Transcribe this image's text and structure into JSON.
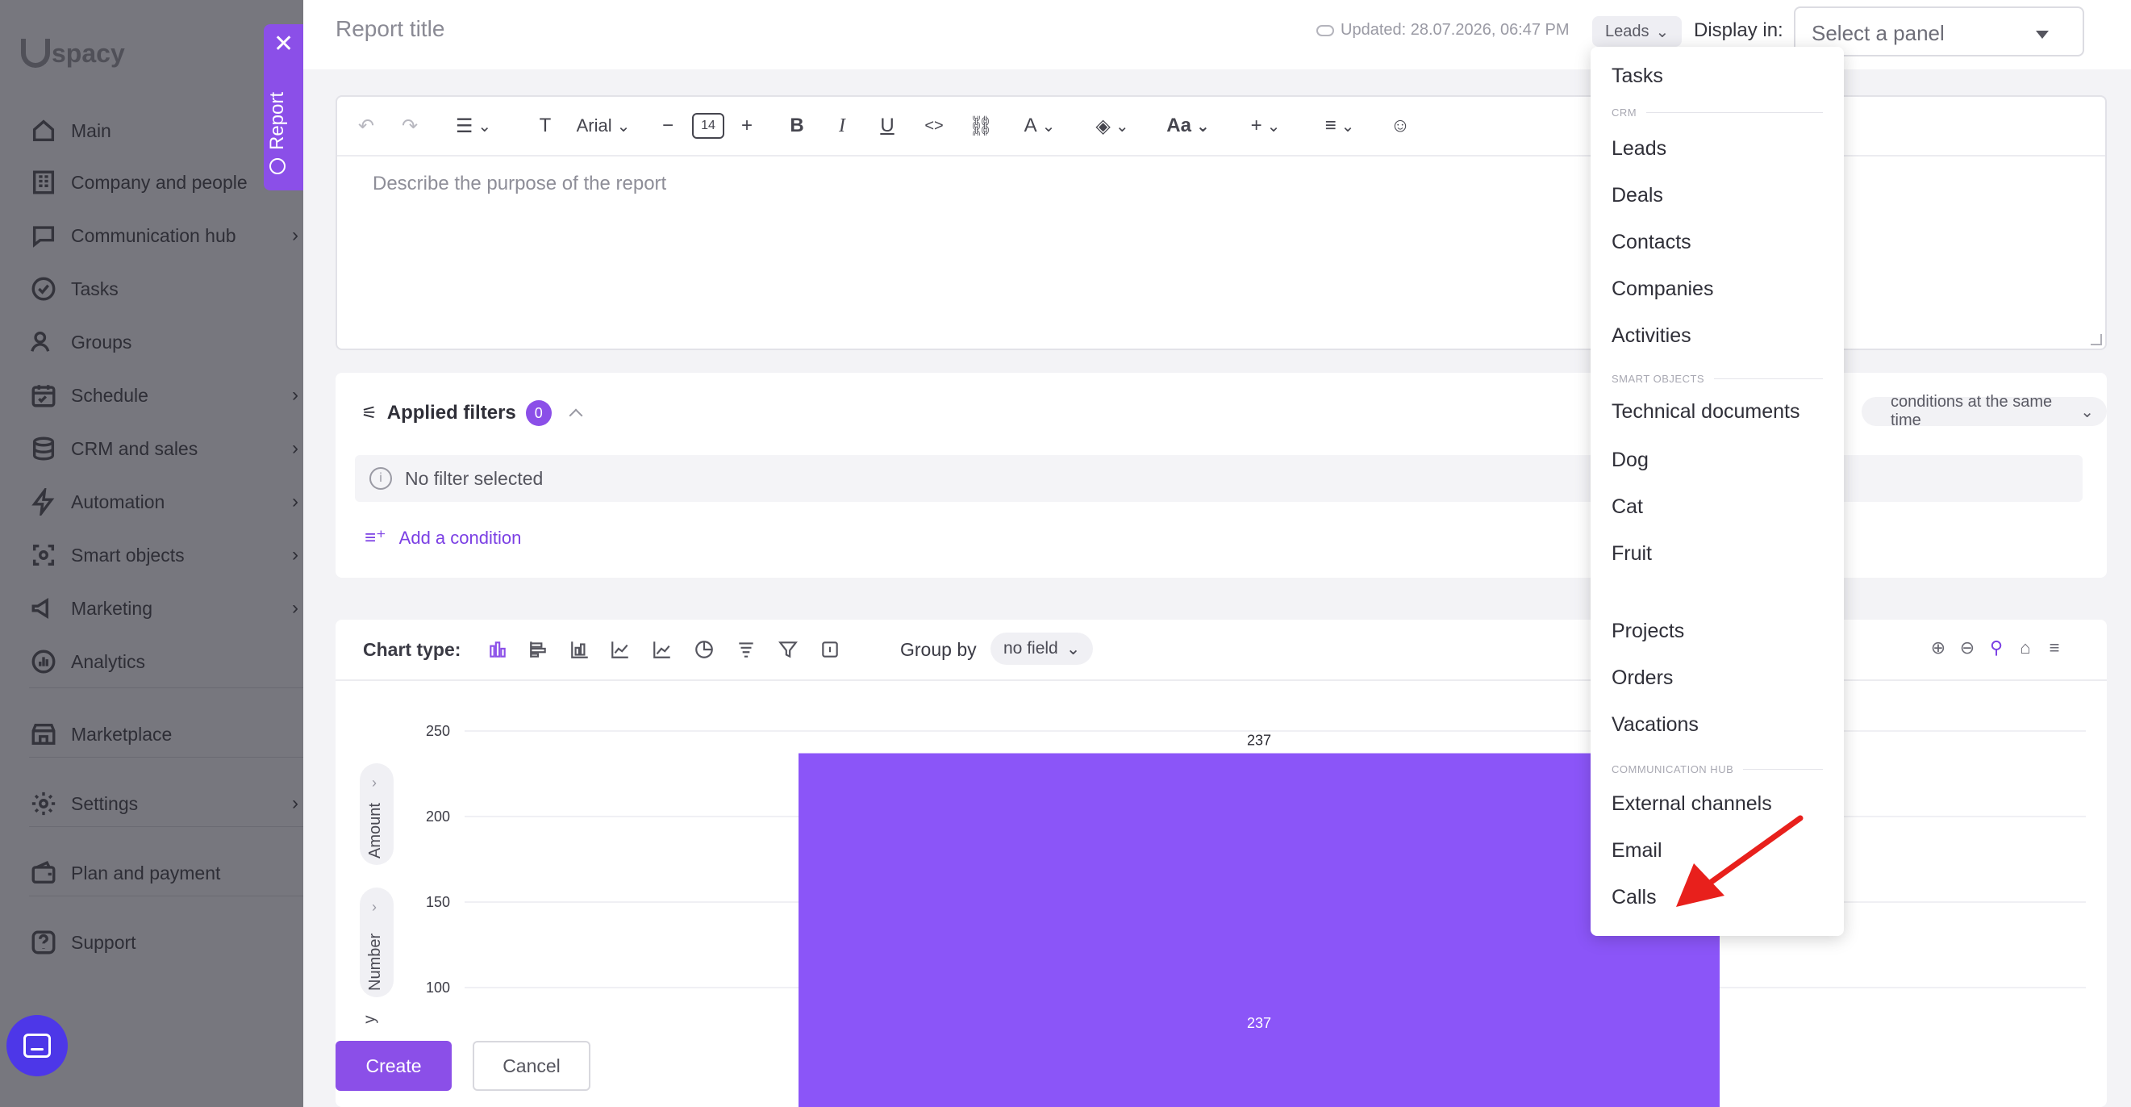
{
  "app": {
    "logo_text": "spacy",
    "logo_letter": "U"
  },
  "sidebar": {
    "items": [
      {
        "label": "Main",
        "icon": "home-icon",
        "chevron": false
      },
      {
        "label": "Company and people",
        "icon": "building-icon",
        "chevron": false
      },
      {
        "label": "Communication hub",
        "icon": "chat-icon",
        "chevron": true
      },
      {
        "label": "Tasks",
        "icon": "check-circle-icon",
        "chevron": false
      },
      {
        "label": "Groups",
        "icon": "users-icon",
        "chevron": false
      },
      {
        "label": "Schedule",
        "icon": "calendar-icon",
        "chevron": true
      },
      {
        "label": "CRM and sales",
        "icon": "database-icon",
        "chevron": true
      },
      {
        "label": "Automation",
        "icon": "lightning-icon",
        "chevron": true
      },
      {
        "label": "Smart objects",
        "icon": "smart-object-icon",
        "chevron": true
      },
      {
        "label": "Marketing",
        "icon": "megaphone-icon",
        "chevron": true
      },
      {
        "label": "Analytics",
        "icon": "analytics-icon",
        "chevron": false
      },
      {
        "label": "Marketplace",
        "icon": "store-icon",
        "chevron": false
      },
      {
        "label": "Settings",
        "icon": "gear-icon",
        "chevron": true
      },
      {
        "label": "Plan and payment",
        "icon": "wallet-icon",
        "chevron": false
      },
      {
        "label": "Support",
        "icon": "help-icon",
        "chevron": false
      }
    ],
    "report_tab_label": "Report"
  },
  "header": {
    "title": "Report title",
    "updated": "Updated: 28.07.2026, 06:47 PM",
    "entity_chip": "Leads",
    "display_in_label": "Display in:",
    "panel_placeholder": "Select a panel"
  },
  "editor": {
    "font_name": "Arial",
    "font_size": "14",
    "placeholder": "Describe the purpose of the report"
  },
  "filters": {
    "title": "Applied filters",
    "count": "0",
    "empty_text": "No filter selected",
    "add_condition": "Add a condition",
    "mode_text": "conditions at the same time"
  },
  "chart": {
    "type_label": "Chart type:",
    "group_by_label": "Group by",
    "group_by_value": "no field",
    "axis_pills": [
      "Amount",
      "Number"
    ],
    "partial_axis_letter": "y"
  },
  "chart_data": {
    "type": "bar",
    "categories": [
      ""
    ],
    "values": [
      237
    ],
    "data_labels": [
      "237",
      "237"
    ],
    "y_ticks": [
      100,
      150,
      200,
      250
    ],
    "ylim": [
      0,
      260
    ],
    "grid": true,
    "bar_color": "#8b55f8"
  },
  "actions": {
    "create": "Create",
    "cancel": "Cancel"
  },
  "dropdown": {
    "entries": [
      {
        "kind": "item",
        "label": "Tasks",
        "top": 0
      },
      {
        "kind": "group",
        "label": "CRM"
      },
      {
        "kind": "item",
        "label": "Leads"
      },
      {
        "kind": "item",
        "label": "Deals"
      },
      {
        "kind": "item",
        "label": "Contacts"
      },
      {
        "kind": "item",
        "label": "Companies"
      },
      {
        "kind": "item",
        "label": "Activities"
      },
      {
        "kind": "group",
        "label": "SMART OBJECTS"
      },
      {
        "kind": "item",
        "label": "Technical documents"
      },
      {
        "kind": "item",
        "label": "Dog"
      },
      {
        "kind": "item",
        "label": "Cat"
      },
      {
        "kind": "item",
        "label": "Fruit"
      },
      {
        "kind": "item",
        "label": "Projects"
      },
      {
        "kind": "item",
        "label": "Orders"
      },
      {
        "kind": "item",
        "label": "Vacations"
      },
      {
        "kind": "group",
        "label": "COMMUNICATION HUB"
      },
      {
        "kind": "item",
        "label": "External channels"
      },
      {
        "kind": "item",
        "label": "Email"
      },
      {
        "kind": "item",
        "label": "Calls"
      }
    ]
  },
  "colors": {
    "accent": "#8b4fe8",
    "annotation_arrow": "#e8201c"
  }
}
